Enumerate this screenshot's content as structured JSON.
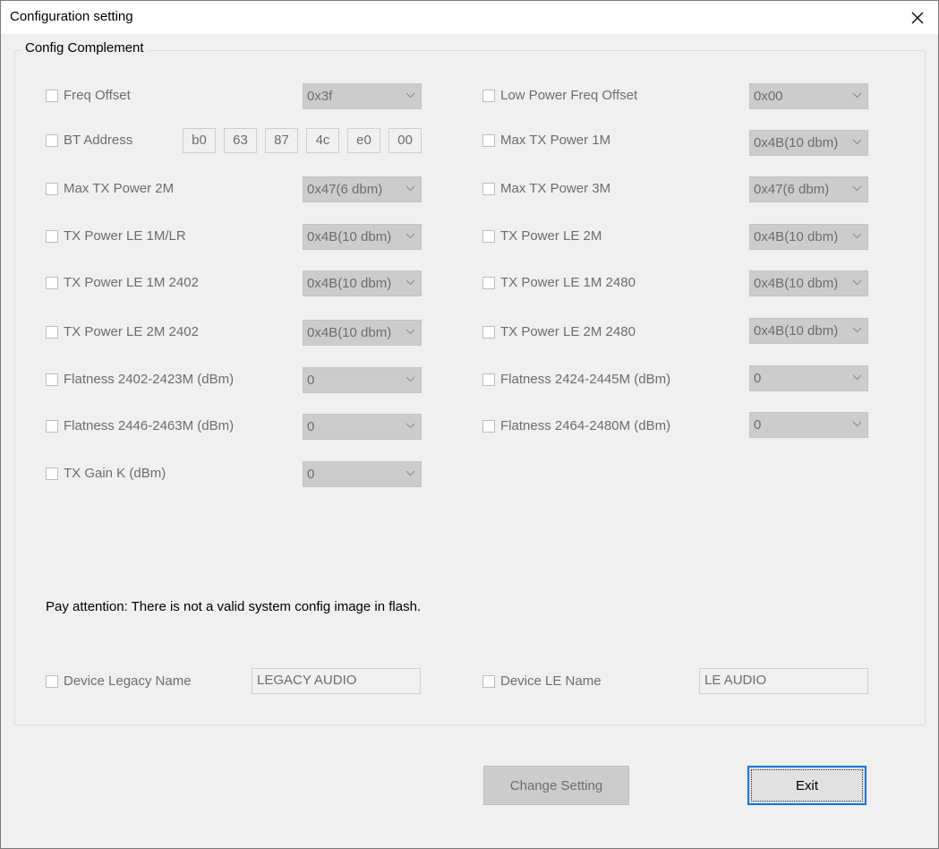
{
  "window": {
    "title": "Configuration setting"
  },
  "group": {
    "legend": "Config Complement"
  },
  "left_settings": [
    {
      "label": "Freq Offset",
      "value": "0x3f"
    },
    {
      "label": "BT Address",
      "address": [
        "b0",
        "63",
        "87",
        "4c",
        "e0",
        "00"
      ]
    },
    {
      "label": "Max TX Power 2M",
      "value": "0x47(6 dbm)"
    },
    {
      "label": "TX Power LE 1M/LR",
      "value": "0x4B(10 dbm)"
    },
    {
      "label": "TX Power LE 1M 2402",
      "value": "0x4B(10 dbm)"
    },
    {
      "label": "TX Power LE 2M 2402",
      "value": "0x4B(10 dbm)"
    },
    {
      "label": "Flatness 2402-2423M (dBm)",
      "value": "0"
    },
    {
      "label": "Flatness 2446-2463M (dBm)",
      "value": "0"
    },
    {
      "label": "TX Gain K (dBm)",
      "value": "0"
    }
  ],
  "right_settings": [
    {
      "label": "Low Power Freq Offset",
      "value": "0x00"
    },
    {
      "label": "Max TX Power 1M",
      "value": "0x4B(10 dbm)"
    },
    {
      "label": "Max TX Power 3M",
      "value": "0x47(6 dbm)"
    },
    {
      "label": "TX Power LE 2M",
      "value": "0x4B(10 dbm)"
    },
    {
      "label": "TX Power LE 1M 2480",
      "value": "0x4B(10 dbm)"
    },
    {
      "label": "TX Power LE 2M 2480",
      "value": "0x4B(10 dbm)"
    },
    {
      "label": "Flatness 2424-2445M (dBm)",
      "value": "0"
    },
    {
      "label": "Flatness 2464-2480M (dBm)",
      "value": "0"
    }
  ],
  "notice": "Pay attention:  There is not a valid system config image in flash.",
  "names": {
    "legacy_label": "Device Legacy Name",
    "legacy_value": "LEGACY AUDIO",
    "le_label": "Device LE Name",
    "le_value": "LE AUDIO"
  },
  "buttons": {
    "change": "Change Setting",
    "exit": "Exit"
  },
  "colors": {
    "accent": "#0078d7",
    "disabled_text": "#6d6d6d",
    "disabled_fill": "#cccccc"
  }
}
